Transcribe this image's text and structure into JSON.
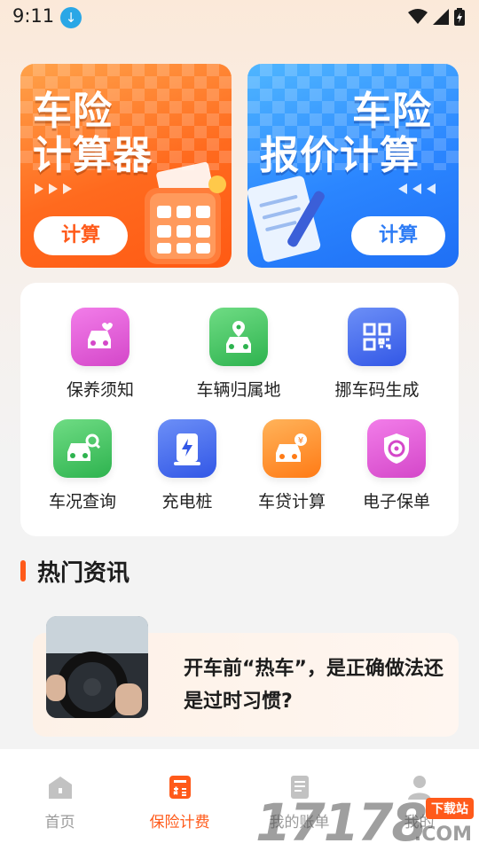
{
  "status_bar": {
    "time": "9:11",
    "download_glyph": "↓"
  },
  "banners": [
    {
      "title_line1": "车险",
      "title_line2": "计算器",
      "button": "计算",
      "accent": "#ff5a1a"
    },
    {
      "title_line1": "车险",
      "title_line2": "报价计算",
      "button": "计算",
      "accent": "#2d7cf5"
    }
  ],
  "tools": [
    {
      "label": "保养须知",
      "icon": "car-heart-icon",
      "color": "#e05bd8"
    },
    {
      "label": "车辆归属地",
      "icon": "car-location-icon",
      "color": "#35c25a"
    },
    {
      "label": "挪车码生成",
      "icon": "qr-code-icon",
      "color": "#3f6cf0"
    },
    {
      "label": "车况查询",
      "icon": "car-search-icon",
      "color": "#35c25a"
    },
    {
      "label": "充电桩",
      "icon": "charging-pile-icon",
      "color": "#3f6cf0"
    },
    {
      "label": "车贷计算",
      "icon": "car-loan-icon",
      "color": "#ff8a1e"
    },
    {
      "label": "电子保单",
      "icon": "shield-steering-icon",
      "color": "#e05bd8"
    }
  ],
  "hot_news": {
    "section_title": "热门资讯",
    "items": [
      {
        "title": "开车前“热车”，是正确做法还是过时习惯?"
      }
    ]
  },
  "bottom_nav": [
    {
      "label": "首页",
      "icon": "home-icon",
      "active": false
    },
    {
      "label": "保险计费",
      "icon": "calculator-icon",
      "active": true
    },
    {
      "label": "我的账单",
      "icon": "bill-icon",
      "active": false
    },
    {
      "label": "我的",
      "icon": "user-icon",
      "active": false
    }
  ],
  "watermark": {
    "number": "17178",
    "tag": "下载站",
    "suffix": ".COM"
  },
  "colors": {
    "accent": "#ff5a1a",
    "inactive": "#9a9a9a"
  }
}
